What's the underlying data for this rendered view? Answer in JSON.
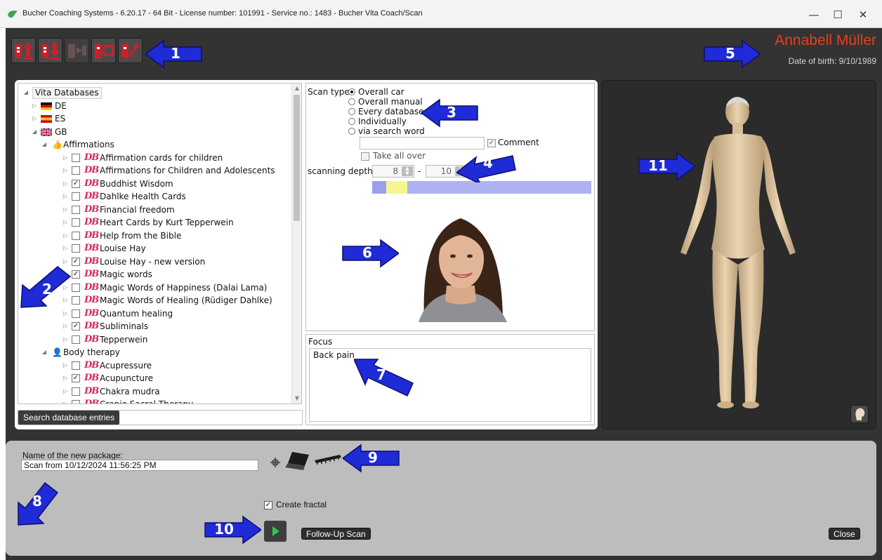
{
  "window": {
    "title": "Bucher Coaching Systems - 6.20.17 - 64 Bit - License number: 101991 - Service no.: 1483 - Bucher Vita Coach/Scan",
    "minimize": "—",
    "maximize": "☐",
    "close": "✕"
  },
  "patient": {
    "name": "Annabell Müller",
    "dob": "Date of birth: 9/10/1989"
  },
  "tree": {
    "root": "Vita Databases",
    "countries": [
      "DE",
      "ES",
      "GB"
    ],
    "affirmations_label": "Affirmations",
    "body_therapy_label": "Body therapy",
    "db_mark": "DB",
    "affirmations": [
      {
        "label": "Affirmation cards for children",
        "checked": false
      },
      {
        "label": "Affirmations for Children and Adolescents",
        "checked": false
      },
      {
        "label": "Buddhist Wisdom",
        "checked": true
      },
      {
        "label": "Dahlke Health Cards",
        "checked": false
      },
      {
        "label": "Financial freedom",
        "checked": false
      },
      {
        "label": "Heart Cards by Kurt Tepperwein",
        "checked": false
      },
      {
        "label": "Help from the Bible",
        "checked": false
      },
      {
        "label": "Louise Hay",
        "checked": false
      },
      {
        "label": "Louise Hay - new version",
        "checked": true
      },
      {
        "label": "Magic words",
        "checked": true
      },
      {
        "label": "Magic Words of Happiness (Dalai Lama)",
        "checked": false
      },
      {
        "label": "Magic Words of Healing (Rüdiger Dahlke)",
        "checked": false
      },
      {
        "label": "Quantum healing",
        "checked": false
      },
      {
        "label": "Subliminals",
        "checked": true
      },
      {
        "label": "Tepperwein",
        "checked": false
      }
    ],
    "body_therapy": [
      {
        "label": "Acupressure",
        "checked": false
      },
      {
        "label": "Acupuncture",
        "checked": true
      },
      {
        "label": "Chakra mudra",
        "checked": false
      },
      {
        "label": "Cranio Sacral Therapy",
        "checked": false
      }
    ]
  },
  "search_button": "Search database entries",
  "scan": {
    "type_label": "Scan type",
    "options": [
      "Overall car",
      "Overall manual",
      "Every database",
      "Individually",
      "via search word"
    ],
    "selected": "Overall car",
    "comment_label": "Comment",
    "take_all_over_label": "Take all over",
    "depth_label": "scanning depth:",
    "depth_from": "8",
    "depth_to": "10",
    "depth_separator": "-"
  },
  "focus": {
    "title": "Focus",
    "value": "Back pain"
  },
  "package": {
    "name_label": "Name of the new package:",
    "name_value": "Scan from 10/12/2024 11:56:25 PM",
    "create_fractal_label": "Create fractal",
    "create_fractal_checked": true,
    "follow_up_label": "Follow-Up Scan",
    "close_label": "Close"
  },
  "callouts": [
    "1",
    "2",
    "3",
    "4",
    "5",
    "6",
    "7",
    "8",
    "9",
    "10",
    "11"
  ],
  "colors": {
    "accent_name": "#e83f1d",
    "callout_blue": "#1f2bd6",
    "db_mark": "#d8285d",
    "app_bg": "#333333"
  }
}
